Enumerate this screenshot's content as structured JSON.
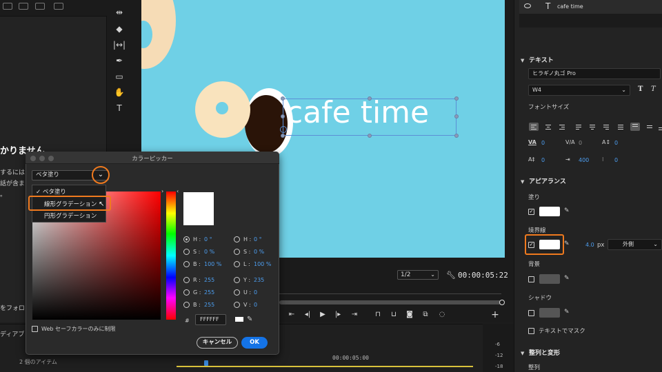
{
  "left": {
    "heading": "かりません",
    "lines": [
      "するには",
      "話が含ま",
      "。"
    ],
    "follow": "をフォロ"
  },
  "tools": [
    "track-select-icon",
    "razor-icon",
    "slip-icon",
    "pen-icon",
    "rectangle-icon",
    "hand-icon",
    "type-icon"
  ],
  "program": {
    "title_text": "cafe time",
    "fraction": "1/2",
    "timecode": "00:00:05:22"
  },
  "timeline": {
    "label_1": "ディアブ",
    "label_2": "2 個のアイテム",
    "ruler_tc": "00:00:05:00",
    "meter": [
      "-6",
      "-12",
      "-18"
    ]
  },
  "properties": {
    "layer_name": "cafe time",
    "text_section": "テキスト",
    "font": "ヒラギノ丸ゴ Pro",
    "weight": "W4",
    "bold_glyph": "T",
    "italic_glyph": "T",
    "font_size_label": "フォントサイズ",
    "kerning": {
      "label": "VA",
      "value": "0"
    },
    "tracking": {
      "label": "V/A",
      "value": "0"
    },
    "baseline": {
      "label": "A↕",
      "value": "0"
    },
    "leading": {
      "label": "A‡",
      "value": "0"
    },
    "tab_width": {
      "label": "⇥",
      "value": "400"
    },
    "tsume": {
      "label": "⁝",
      "value": "0"
    },
    "appearance_section": "アピアランス",
    "fill_label": "塗り",
    "stroke_label": "境界線",
    "stroke_width": "4.0",
    "stroke_unit": "px",
    "stroke_position": "外側",
    "background_label": "背景",
    "shadow_label": "シャドウ",
    "mask_label": "テキストでマスク",
    "align_section": "整列と変形",
    "align_label": "整列",
    "fill_color": "#ffffff",
    "stroke_color": "#ffffff",
    "bg_color": "#555555",
    "shadow_color": "#555555"
  },
  "picker": {
    "title": "カラーピッカー",
    "fill_type": "ベタ塗り",
    "menu": [
      {
        "label": "ベタ塗り",
        "checked": "✓"
      },
      {
        "label": "線形グラデーション",
        "checked": ""
      },
      {
        "label": "円形グラデーション",
        "checked": ""
      }
    ],
    "channels_left": [
      {
        "label": "H :",
        "value": "0 °"
      },
      {
        "label": "S :",
        "value": "0 %"
      },
      {
        "label": "B :",
        "value": "100 %"
      },
      {
        "label": "R :",
        "value": "255"
      },
      {
        "label": "G :",
        "value": "255"
      },
      {
        "label": "B :",
        "value": "255"
      }
    ],
    "channels_right": [
      {
        "label": "H :",
        "value": "0 °"
      },
      {
        "label": "S :",
        "value": "0 %"
      },
      {
        "label": "L :",
        "value": "100 %"
      },
      {
        "label": "Y :",
        "value": "235"
      },
      {
        "label": "U :",
        "value": "0"
      },
      {
        "label": "V :",
        "value": "0"
      }
    ],
    "hex": "FFFFFF",
    "hash": "#",
    "websafe": "Web セーフカラーのみに制限",
    "cancel": "キャンセル",
    "ok": "OK"
  },
  "colors": {
    "accent_highlight": "#f07a1e",
    "ok_blue": "#1473e6",
    "value_blue": "#4d9ef0",
    "canvas_cyan": "#6fd0e6"
  }
}
